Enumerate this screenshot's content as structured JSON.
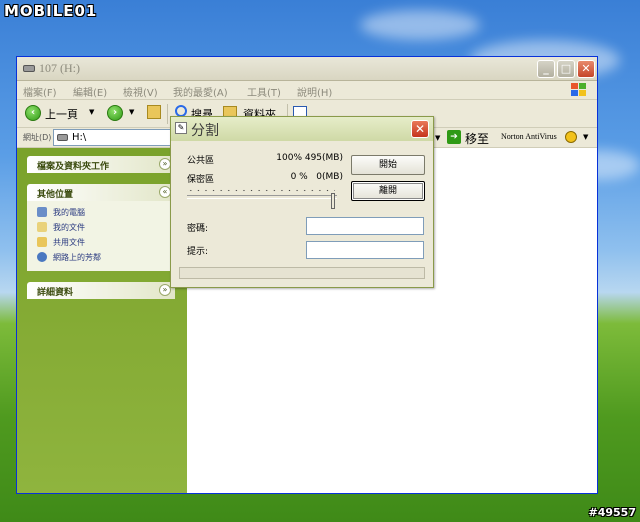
{
  "watermark": {
    "logo": "MOBILE01",
    "post_id": "#49557"
  },
  "window": {
    "title": "107 (H:)",
    "menu": [
      "檔案(F)",
      "編輯(E)",
      "檢視(V)",
      "我的最愛(A)",
      "工具(T)",
      "說明(H)"
    ],
    "toolbar": {
      "back": "上一頁",
      "search": "搜尋",
      "folders": "資料夾"
    },
    "address": {
      "label": "網址(D)",
      "value": "H:\\",
      "go": "移至",
      "norton": "Norton AntiVirus"
    }
  },
  "sidebar": {
    "panels": [
      {
        "title": "檔案及資料夾工作",
        "chevron": "»",
        "items": []
      },
      {
        "title": "其他位置",
        "chevron": "«",
        "items": [
          {
            "label": "我的電腦",
            "icon": "computer-icon"
          },
          {
            "label": "我的文件",
            "icon": "documents-icon"
          },
          {
            "label": "共用文件",
            "icon": "shared-folder-icon"
          },
          {
            "label": "網路上的芳鄰",
            "icon": "network-icon"
          }
        ]
      },
      {
        "title": "詳細資料",
        "chevron": "»",
        "items": []
      }
    ]
  },
  "dialog": {
    "title": "分割",
    "public_label": "公共區",
    "public_value": "100% 495(MB)",
    "private_label": "保密區",
    "private_value": "0 %   0(MB)",
    "start_button": "開始",
    "close_button": "離開",
    "password_label": "密碼:",
    "hint_label": "提示:",
    "slider_percent": 100
  },
  "colors": {
    "accent": "#0831d9",
    "sidebar": "#7aa22b",
    "dialog_bg": "#ece9d8"
  }
}
